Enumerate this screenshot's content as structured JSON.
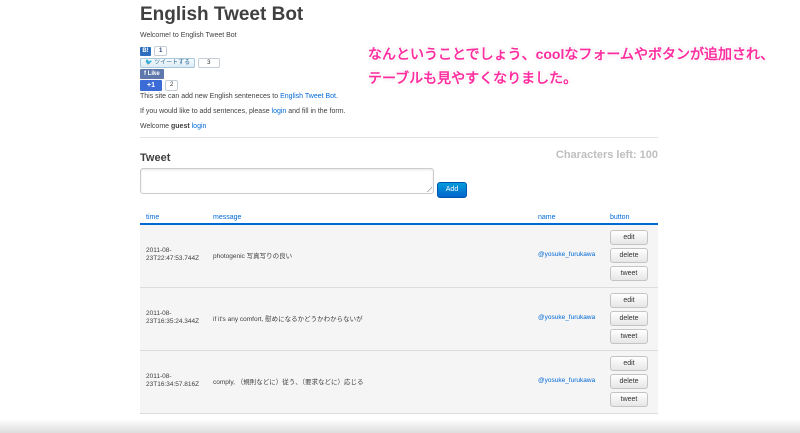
{
  "app": {
    "title": "English Tweet Bot",
    "welcome": "Welcome! to English Tweet Bot"
  },
  "social": {
    "hatena_icon": "B!",
    "hatena_count": "1",
    "tweet_label": "ツイートする",
    "tweet_count": "3",
    "fb_label": "Like",
    "gplus_label": "+1",
    "gplus_count": "2"
  },
  "info": {
    "site_prefix": "This site can add new English senteneces to ",
    "site_link": "English Tweet Bot",
    "site_suffix": ".",
    "login_prefix": "If you would like to add sentences, please ",
    "login_link": "login",
    "login_suffix": " and fill in the form.",
    "welcome_prefix": "Welcome ",
    "guest": "guest",
    "guest_login": "login"
  },
  "form": {
    "heading": "Tweet",
    "chars_left": "Characters left: 100",
    "add_label": "Add"
  },
  "table": {
    "headers": [
      "time",
      "message",
      "name",
      "button"
    ],
    "rows": [
      {
        "time": "2011-08-23T22:47:53.744Z",
        "message": "photogenic 写真写りの良い",
        "name": "@yosuke_furukawa"
      },
      {
        "time": "2011-08-23T16:35:24.344Z",
        "message": "if it's any comfort, 慰めになるかどうかわからないが",
        "name": "@yosuke_furukawa"
      },
      {
        "time": "2011-08-23T16:34:57.816Z",
        "message": "comply, （規則などに）従う、（要求などに）応じる",
        "name": "@yosuke_furukawa"
      }
    ],
    "row_buttons": [
      "edit",
      "delete",
      "tweet"
    ]
  },
  "annotation": {
    "line1": "なんということでしょう、coolなフォームやボタンが追加され、",
    "line2": "テーブルも見やすくなりました。"
  },
  "colors": {
    "link": "#0069d6",
    "annotation": "#ff2ea0",
    "add_button": "#0064cd"
  }
}
